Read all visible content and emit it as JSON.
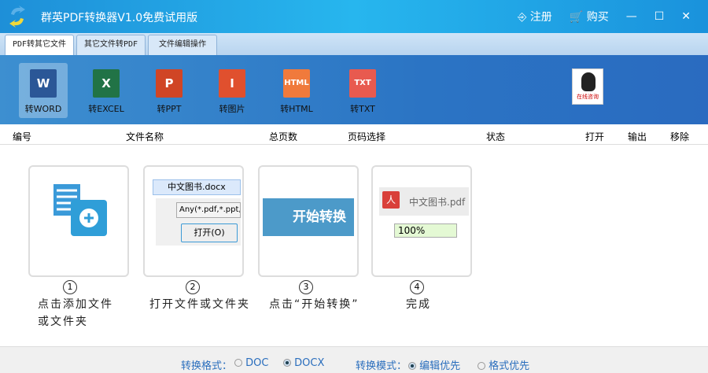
{
  "app": {
    "title": "群英PDF转换器V1.0免费试用版",
    "register": "注册",
    "buy": "购买",
    "minimize": "—",
    "maximize": "☐",
    "close": "✕"
  },
  "tabs": [
    {
      "label": "PDF转其它文件"
    },
    {
      "label": "其它文件转PDF"
    },
    {
      "label": "文件编辑操作"
    }
  ],
  "tools": [
    {
      "label": "转WORD",
      "glyph": "W",
      "color": "#2b5797"
    },
    {
      "label": "转EXCEL",
      "glyph": "X",
      "color": "#217346"
    },
    {
      "label": "转PPT",
      "glyph": "P",
      "color": "#d04525"
    },
    {
      "label": "转图片",
      "glyph": "I",
      "color": "#e0502e"
    },
    {
      "label": "转HTML",
      "glyph": "HTML",
      "color": "#f07a3c"
    },
    {
      "label": "转TXT",
      "glyph": "TXT",
      "color": "#e85a4f"
    }
  ],
  "qq": {
    "label": "在线咨询"
  },
  "columns": [
    "编号",
    "文件名称",
    "总页数",
    "页码选择",
    "状态",
    "打开",
    "输出",
    "移除"
  ],
  "steps": [
    {
      "num": "1",
      "text": "点击添加文件",
      "text2": "或文件夹"
    },
    {
      "num": "2",
      "text": "打开文件或文件夹",
      "file": "中文图书.docx",
      "filter": "Any(*.pdf,*.ppt,*",
      "open": "打开(O)"
    },
    {
      "num": "3",
      "text": "点击“开始转换”",
      "button": "开始转换"
    },
    {
      "num": "4",
      "text": "完成",
      "file": "中文图书.pdf",
      "progress": "100%"
    }
  ],
  "footer": {
    "format_label": "转换格式：",
    "doc": "DOC",
    "docx": "DOCX",
    "mode_label": "转换模式：",
    "edit_first": "编辑优先",
    "format_first": "格式优先",
    "selected_format": "DOCX",
    "selected_mode": "编辑优先"
  }
}
